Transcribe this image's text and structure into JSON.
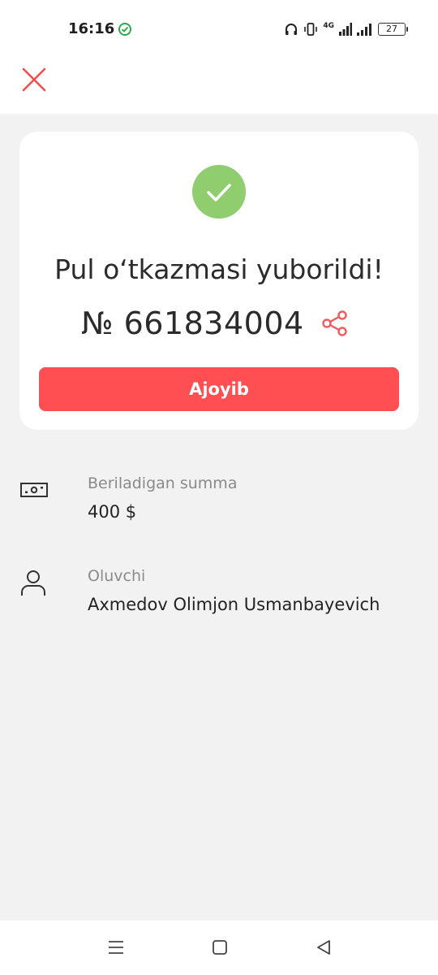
{
  "status_bar": {
    "time": "16:16",
    "network": "4G",
    "battery": "27"
  },
  "header": {
    "close_icon": "close-icon"
  },
  "success_card": {
    "status_icon": "check-circle-icon",
    "title": "Pul o‘tkazmasi yuborildi!",
    "transfer_number": "№ 661834004",
    "share_icon": "share-icon",
    "primary_button": "Ajoyib"
  },
  "details": [
    {
      "icon": "banknote-icon",
      "label": "Beriladigan summa",
      "value": "400 $"
    },
    {
      "icon": "user-icon",
      "label": "Oluvchi",
      "value": "Axmedov Olimjon Usmanbayevich"
    }
  ],
  "nav_bar": {
    "menu_icon": "menu-icon",
    "home_icon": "home-square-icon",
    "back_icon": "back-triangle-icon"
  },
  "colors": {
    "accent": "#ff4f52",
    "success": "#8fcd6e",
    "background": "#f2f2f3"
  }
}
